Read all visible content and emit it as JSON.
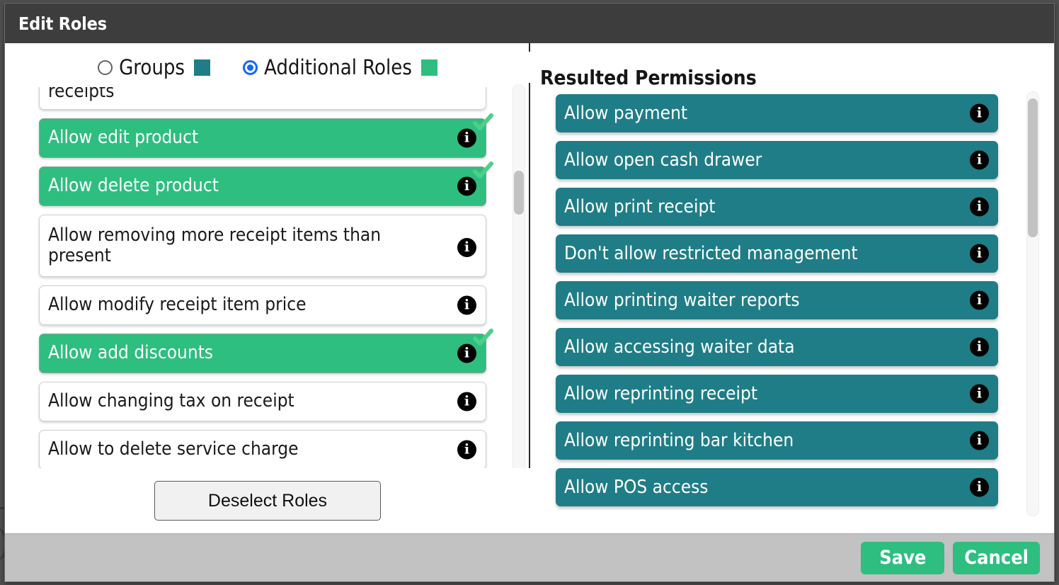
{
  "window": {
    "title": "Edit Roles"
  },
  "mode_selector": {
    "options": [
      {
        "label": "Groups",
        "selected": false,
        "swatch_color": "#1f7d87"
      },
      {
        "label": "Additional Roles",
        "selected": true,
        "swatch_color": "#2ebe7f"
      }
    ]
  },
  "left_panel": {
    "roles": [
      {
        "label": "receipts",
        "selected": false,
        "clipped_top": true
      },
      {
        "label": "Allow edit product",
        "selected": true
      },
      {
        "label": "Allow delete product",
        "selected": true
      },
      {
        "label": "Allow removing more receipt items than present",
        "selected": false
      },
      {
        "label": "Allow modify receipt item price",
        "selected": false
      },
      {
        "label": "Allow add discounts",
        "selected": true
      },
      {
        "label": "Allow changing tax on receipt",
        "selected": false
      },
      {
        "label": "Allow to delete service charge",
        "selected": false,
        "clipped_bottom": true
      }
    ],
    "deselect_button": "Deselect Roles",
    "info_icon": "info-icon",
    "check_icon": "check-icon"
  },
  "right_panel": {
    "heading": "Resulted Permissions",
    "permissions": [
      {
        "label": "Allow payment"
      },
      {
        "label": "Allow open cash drawer"
      },
      {
        "label": "Allow print receipt"
      },
      {
        "label": "Don't allow restricted management"
      },
      {
        "label": "Allow printing waiter reports"
      },
      {
        "label": "Allow accessing waiter data"
      },
      {
        "label": "Allow reprinting receipt"
      },
      {
        "label": "Allow reprinting bar kitchen"
      },
      {
        "label": "Allow POS access",
        "clipped_bottom": true
      }
    ]
  },
  "footer": {
    "save_label": "Save",
    "cancel_label": "Cancel"
  },
  "colors": {
    "titlebar": "#3d3d3d",
    "selected_role_green": "#2ebe7f",
    "permission_teal": "#1f7d87",
    "footer_bar": "#c2c2c2",
    "radio_blue": "#1565ff",
    "check_badge": "#4ccf87"
  }
}
